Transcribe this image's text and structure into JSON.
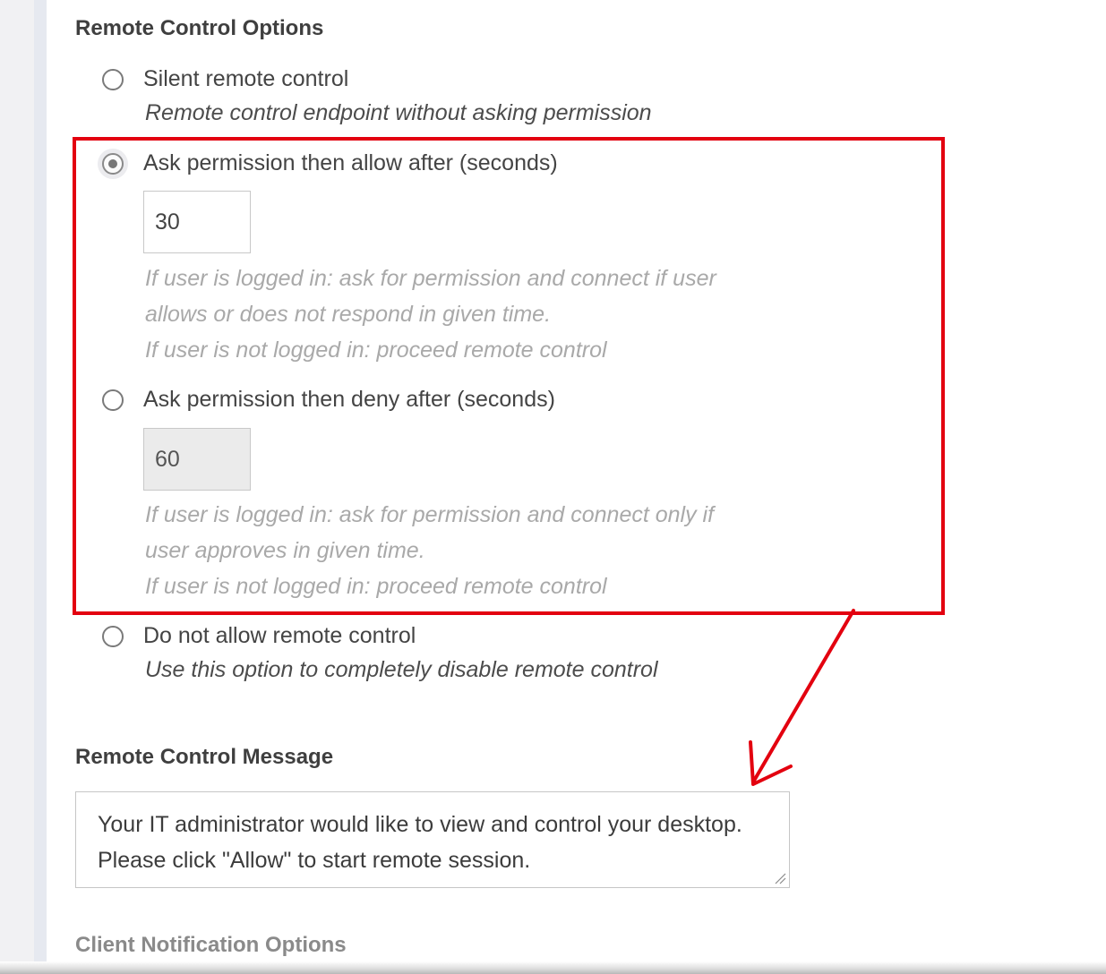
{
  "sections": {
    "remote_control_options": "Remote Control Options",
    "remote_control_message": "Remote Control Message",
    "client_notification_options": "Client Notification Options"
  },
  "options": [
    {
      "label": "Silent remote control",
      "description": "Remote control endpoint without asking permission",
      "checked": false
    },
    {
      "label": "Ask permission then allow after (seconds)",
      "value": "30",
      "hint": "If user is logged in: ask for permission and connect if user\nallows or does not respond in given time.\nIf user is not logged in: proceed remote control",
      "checked": true
    },
    {
      "label": "Ask permission then deny after (seconds)",
      "value": "60",
      "hint": "If user is logged in: ask for permission and connect only if\nuser approves in given time.\nIf user is not logged in: proceed remote control",
      "checked": false
    },
    {
      "label": "Do not allow remote control",
      "description": "Use this option to completely disable remote control",
      "checked": false
    }
  ],
  "message": {
    "text": "Your IT administrator would like to view and control your desktop. Please click \"Allow\" to start remote session."
  },
  "colors": {
    "highlight": "#e3000f",
    "hint_text": "#a9a9a9",
    "disabled_input": "#ebebeb"
  }
}
